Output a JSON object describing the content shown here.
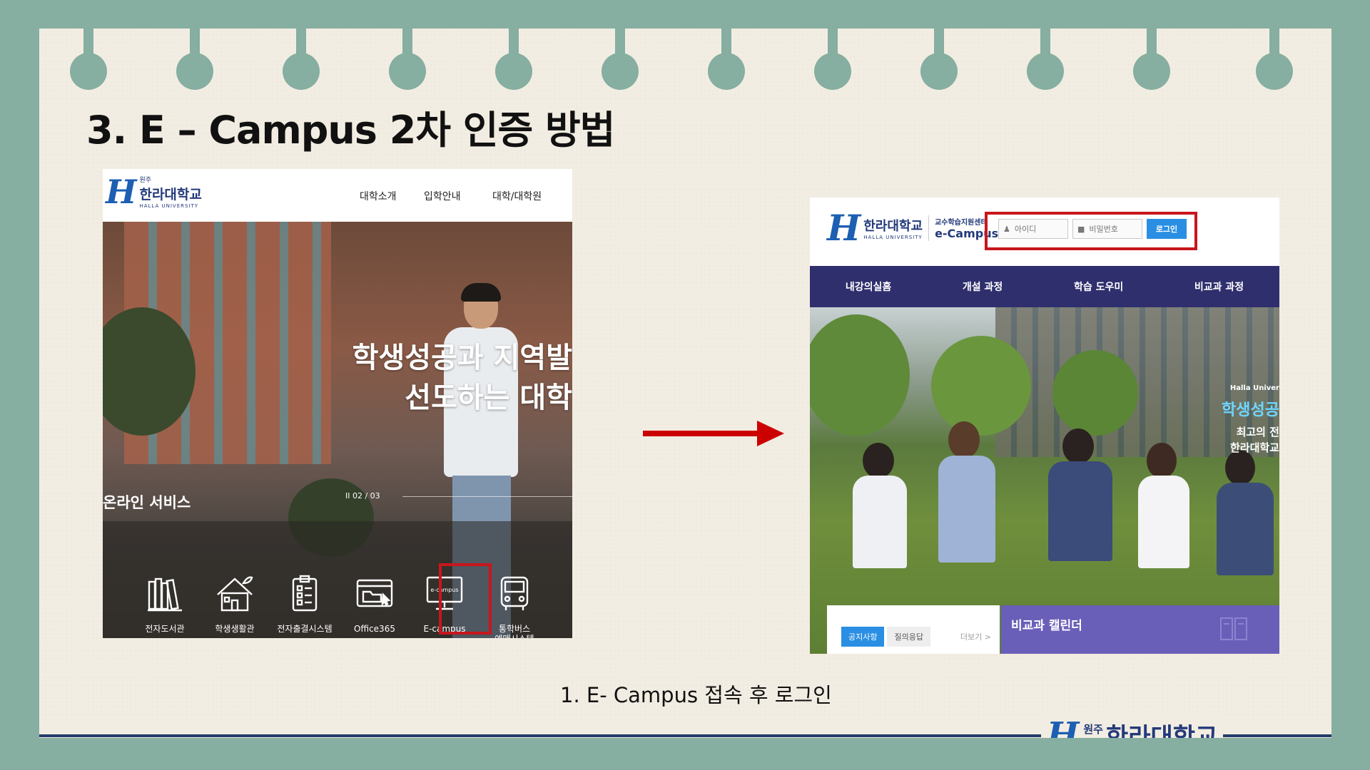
{
  "slide": {
    "title": "3. E – Campus 2차 인증 방법",
    "caption": "1. E- Campus  접속 후 로그인"
  },
  "left_screenshot": {
    "logo": {
      "small": "원주",
      "name": "한라대학교",
      "sub": "HALLA UNIVERSITY"
    },
    "nav": [
      "대학소개",
      "입학안내",
      "대학/대학원"
    ],
    "hero": {
      "line1": "학생성공과 지역발",
      "line2": "선도하는 대학",
      "pager": "II   02 / 03"
    },
    "services_title": "온라인 서비스",
    "services": [
      {
        "label": "전자도서관",
        "icon": "library-icon"
      },
      {
        "label": "학생생활관",
        "icon": "dormitory-icon"
      },
      {
        "label": "전자출결시스템",
        "icon": "attendance-icon"
      },
      {
        "label": "Office365",
        "icon": "office-icon"
      },
      {
        "label": "E-campus",
        "icon": "monitor-icon",
        "screen_text": "e-campus"
      },
      {
        "label": "통학버스\n예매시스템",
        "icon": "bus-icon"
      }
    ]
  },
  "right_screenshot": {
    "logo": {
      "name": "한라대학교",
      "sub": "HALLA UNIVERSITY",
      "center": "교수학습지원센터",
      "ecampus": "e-Campus"
    },
    "login": {
      "id_placeholder": "아이디",
      "pw_placeholder": "비밀번호",
      "button": "로그인"
    },
    "nav": [
      "내강의실홈",
      "개설 과정",
      "학습 도우미",
      "비교과 과정"
    ],
    "hero_side": {
      "small": "Halla Univer",
      "big": "학생성공",
      "line1": "최고의 전",
      "line2": "한라대학교"
    },
    "notice_tabs": [
      "공지사항",
      "질의응답"
    ],
    "more": "더보기 >",
    "calendar_title": "비교과 캘린더"
  },
  "footer_logo": {
    "small": "원주",
    "name": "한라대학교"
  },
  "colors": {
    "background": "#86aea1",
    "paper": "#f2ede2",
    "highlight": "#c8161d",
    "navy": "#243a6b",
    "ecampus_nav": "#2f2f6e",
    "login_button": "#2a8fe3"
  }
}
